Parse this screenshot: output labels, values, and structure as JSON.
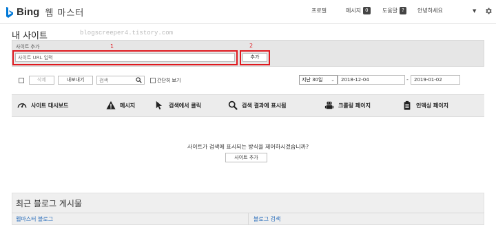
{
  "header": {
    "brand": "Bing",
    "product": "웹 마스터",
    "nav": [
      {
        "label": "프로필",
        "badge": ""
      },
      {
        "label": "메시지",
        "badge": "0"
      },
      {
        "label": "도움말",
        "badge": "?"
      }
    ],
    "greeting": "안녕하세요",
    "brand_color": "#0078d7"
  },
  "page": {
    "title": "내 사이트",
    "watermark": "blogscreeper4.tistory.com"
  },
  "add_site": {
    "label": "사이트 추가",
    "placeholder": "사이트 URL 입력",
    "button": "추가",
    "annotation_1": "1",
    "annotation_2": "2",
    "highlight_color": "#e0191f"
  },
  "toolbar": {
    "delete": "삭제",
    "export": "내보내기",
    "search_placeholder": "검색",
    "simple_view": "간단히 보기",
    "period": "지난 30일",
    "date_from": "2018-12-04",
    "date_sep": "-",
    "date_to": "2019-01-02"
  },
  "tabs": [
    {
      "label": "사이트 대시보드",
      "icon": "gauge-icon"
    },
    {
      "label": "메시지",
      "icon": "warning-icon"
    },
    {
      "label": "검색에서 클릭",
      "icon": "cursor-icon"
    },
    {
      "label": "검색 결과에 표시됨",
      "icon": "magnifier-icon"
    },
    {
      "label": "크롤링 페이지",
      "icon": "robot-icon"
    },
    {
      "label": "인덱싱 페이지",
      "icon": "clipboard-icon"
    }
  ],
  "empty_state": {
    "message": "사이트가 검색에 표시되는 방식을 제어하시겠습니까?",
    "button": "사이트 추가"
  },
  "blog": {
    "title": "최근 블로그 게시물",
    "col_left": "웹마스터 블로그",
    "col_right": "블로그 검색"
  }
}
